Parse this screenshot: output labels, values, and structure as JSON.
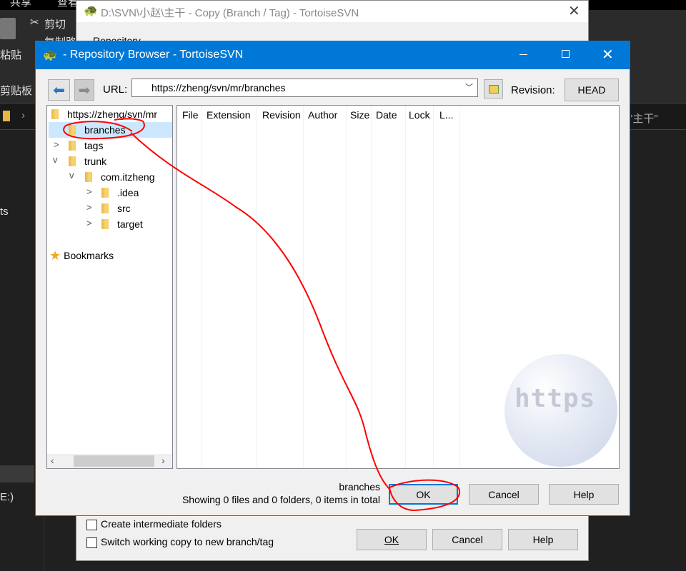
{
  "explorer": {
    "top_tabs": [
      "共享",
      "查看"
    ],
    "cut": "剪切",
    "copy_path": "复制路",
    "paste": "粘贴",
    "clipboard": "剪贴板",
    "nav_item": "ts",
    "drive": "E:)",
    "search_hint": "\"主干\""
  },
  "copy_dialog": {
    "title": "D:\\SVN\\小赵\\主干 - Copy (Branch / Tag) - TortoiseSVN",
    "repository_label": "Repository",
    "create_intermediate": "Create intermediate folders",
    "switch_working_copy": "Switch working copy to new branch/tag",
    "ok": "OK",
    "cancel": "Cancel",
    "help": "Help"
  },
  "repo_browser": {
    "title": "- Repository Browser - TortoiseSVN",
    "url_label": "URL:",
    "url_value": "https://zheng/svn/mr/branches",
    "revision_label": "Revision:",
    "revision_value": "HEAD",
    "tree": [
      {
        "label": "https://zheng/svn/mr",
        "level": 0,
        "expander": "none"
      },
      {
        "label": "branches",
        "level": 1,
        "expander": "none",
        "selected": true
      },
      {
        "label": "tags",
        "level": 1,
        "expander": "collapsed"
      },
      {
        "label": "trunk",
        "level": 1,
        "expander": "expanded"
      },
      {
        "label": "com.itzheng",
        "level": 2,
        "expander": "expanded"
      },
      {
        "label": ".idea",
        "level": 3,
        "expander": "collapsed"
      },
      {
        "label": "src",
        "level": 3,
        "expander": "collapsed"
      },
      {
        "label": "target",
        "level": 3,
        "expander": "collapsed"
      }
    ],
    "bookmarks": "Bookmarks",
    "columns": [
      "File",
      "Extension",
      "Revision",
      "Author",
      "Size",
      "Date",
      "Lock",
      "L..."
    ],
    "watermark": "https",
    "status_path": "branches",
    "status_summary": "Showing 0 files and 0 folders, 0 items in total",
    "ok": "OK",
    "cancel": "Cancel",
    "help": "Help"
  },
  "colors": {
    "title_bar": "#0078d7",
    "selection": "#cce8ff",
    "annotation": "#ff0000"
  }
}
